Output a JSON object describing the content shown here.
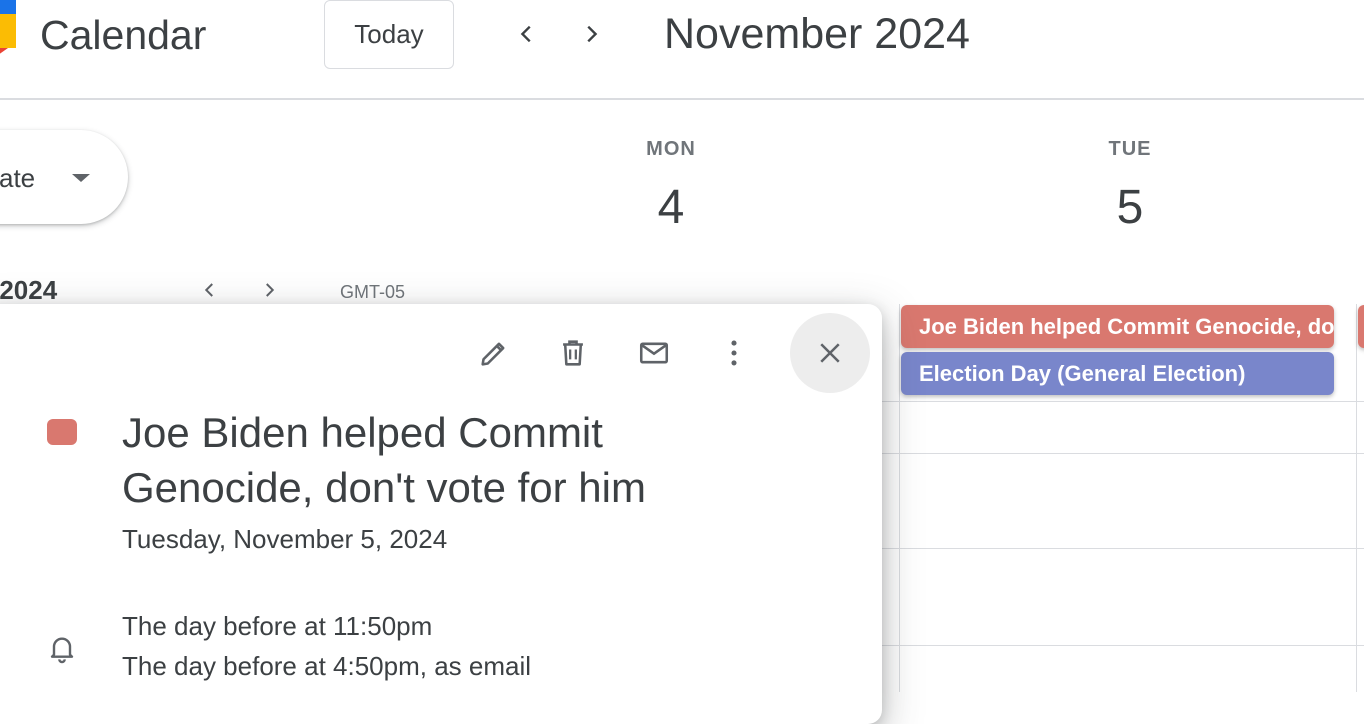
{
  "header": {
    "app_title": "Calendar",
    "today_label": "Today",
    "month_title": "November 2024"
  },
  "sidebar": {
    "create_label": "ate",
    "mini_month_title": "r 2024",
    "timezone": "GMT-05"
  },
  "days": [
    {
      "dow": "MON",
      "num": "4"
    },
    {
      "dow": "TUE",
      "num": "5"
    }
  ],
  "events": [
    {
      "title": "Joe Biden helped Commit Genocide, don't vote for him",
      "color": "#d9786f"
    },
    {
      "title": "Election Day (General Election)",
      "color": "#7986cb"
    }
  ],
  "popover": {
    "title": "Joe Biden helped Commit Genocide, don't vote for him",
    "date": "Tuesday, November 5, 2024",
    "reminders": [
      "The day before at 11:50pm",
      "The day before at 4:50pm, as email"
    ],
    "color": "#d9786f",
    "actions": [
      "pencil-icon",
      "trash-icon",
      "mail-icon",
      "more-vert-icon",
      "close-icon"
    ]
  }
}
